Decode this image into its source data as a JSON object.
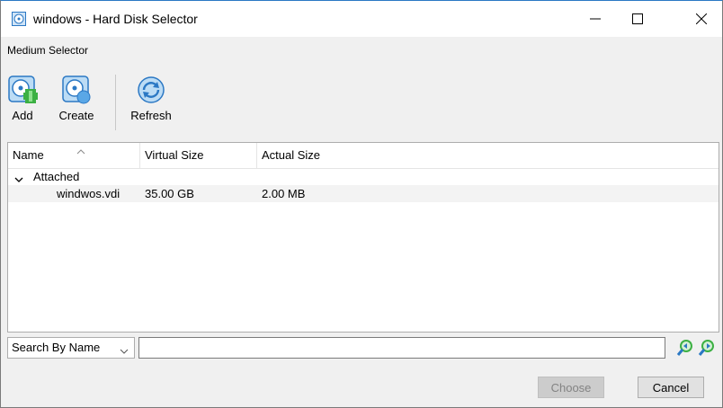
{
  "window": {
    "title": "windows - Hard Disk Selector",
    "subtitle": "Medium Selector"
  },
  "toolbar": {
    "add_label": "Add",
    "create_label": "Create",
    "refresh_label": "Refresh"
  },
  "table": {
    "columns": [
      "Name",
      "Virtual Size",
      "Actual Size"
    ],
    "groups": [
      {
        "label": "Attached",
        "expanded": true,
        "rows": [
          {
            "name": "windwos.vdi",
            "virtual_size": "35.00 GB",
            "actual_size": "2.00 MB"
          }
        ]
      }
    ]
  },
  "search": {
    "mode": "Search By Name",
    "value": ""
  },
  "buttons": {
    "choose_label": "Choose",
    "choose_enabled": false,
    "cancel_label": "Cancel"
  },
  "colors": {
    "accent_blue": "#2b78c4",
    "add_green": "#3cb043",
    "disabled_button": "#cccccc"
  },
  "icons": {
    "title": "virtualbox-disk-icon",
    "add": "disk-add-icon",
    "create": "disk-create-icon",
    "refresh": "disk-refresh-icon",
    "search_prev": "search-previous-icon",
    "search_next": "search-next-icon"
  }
}
